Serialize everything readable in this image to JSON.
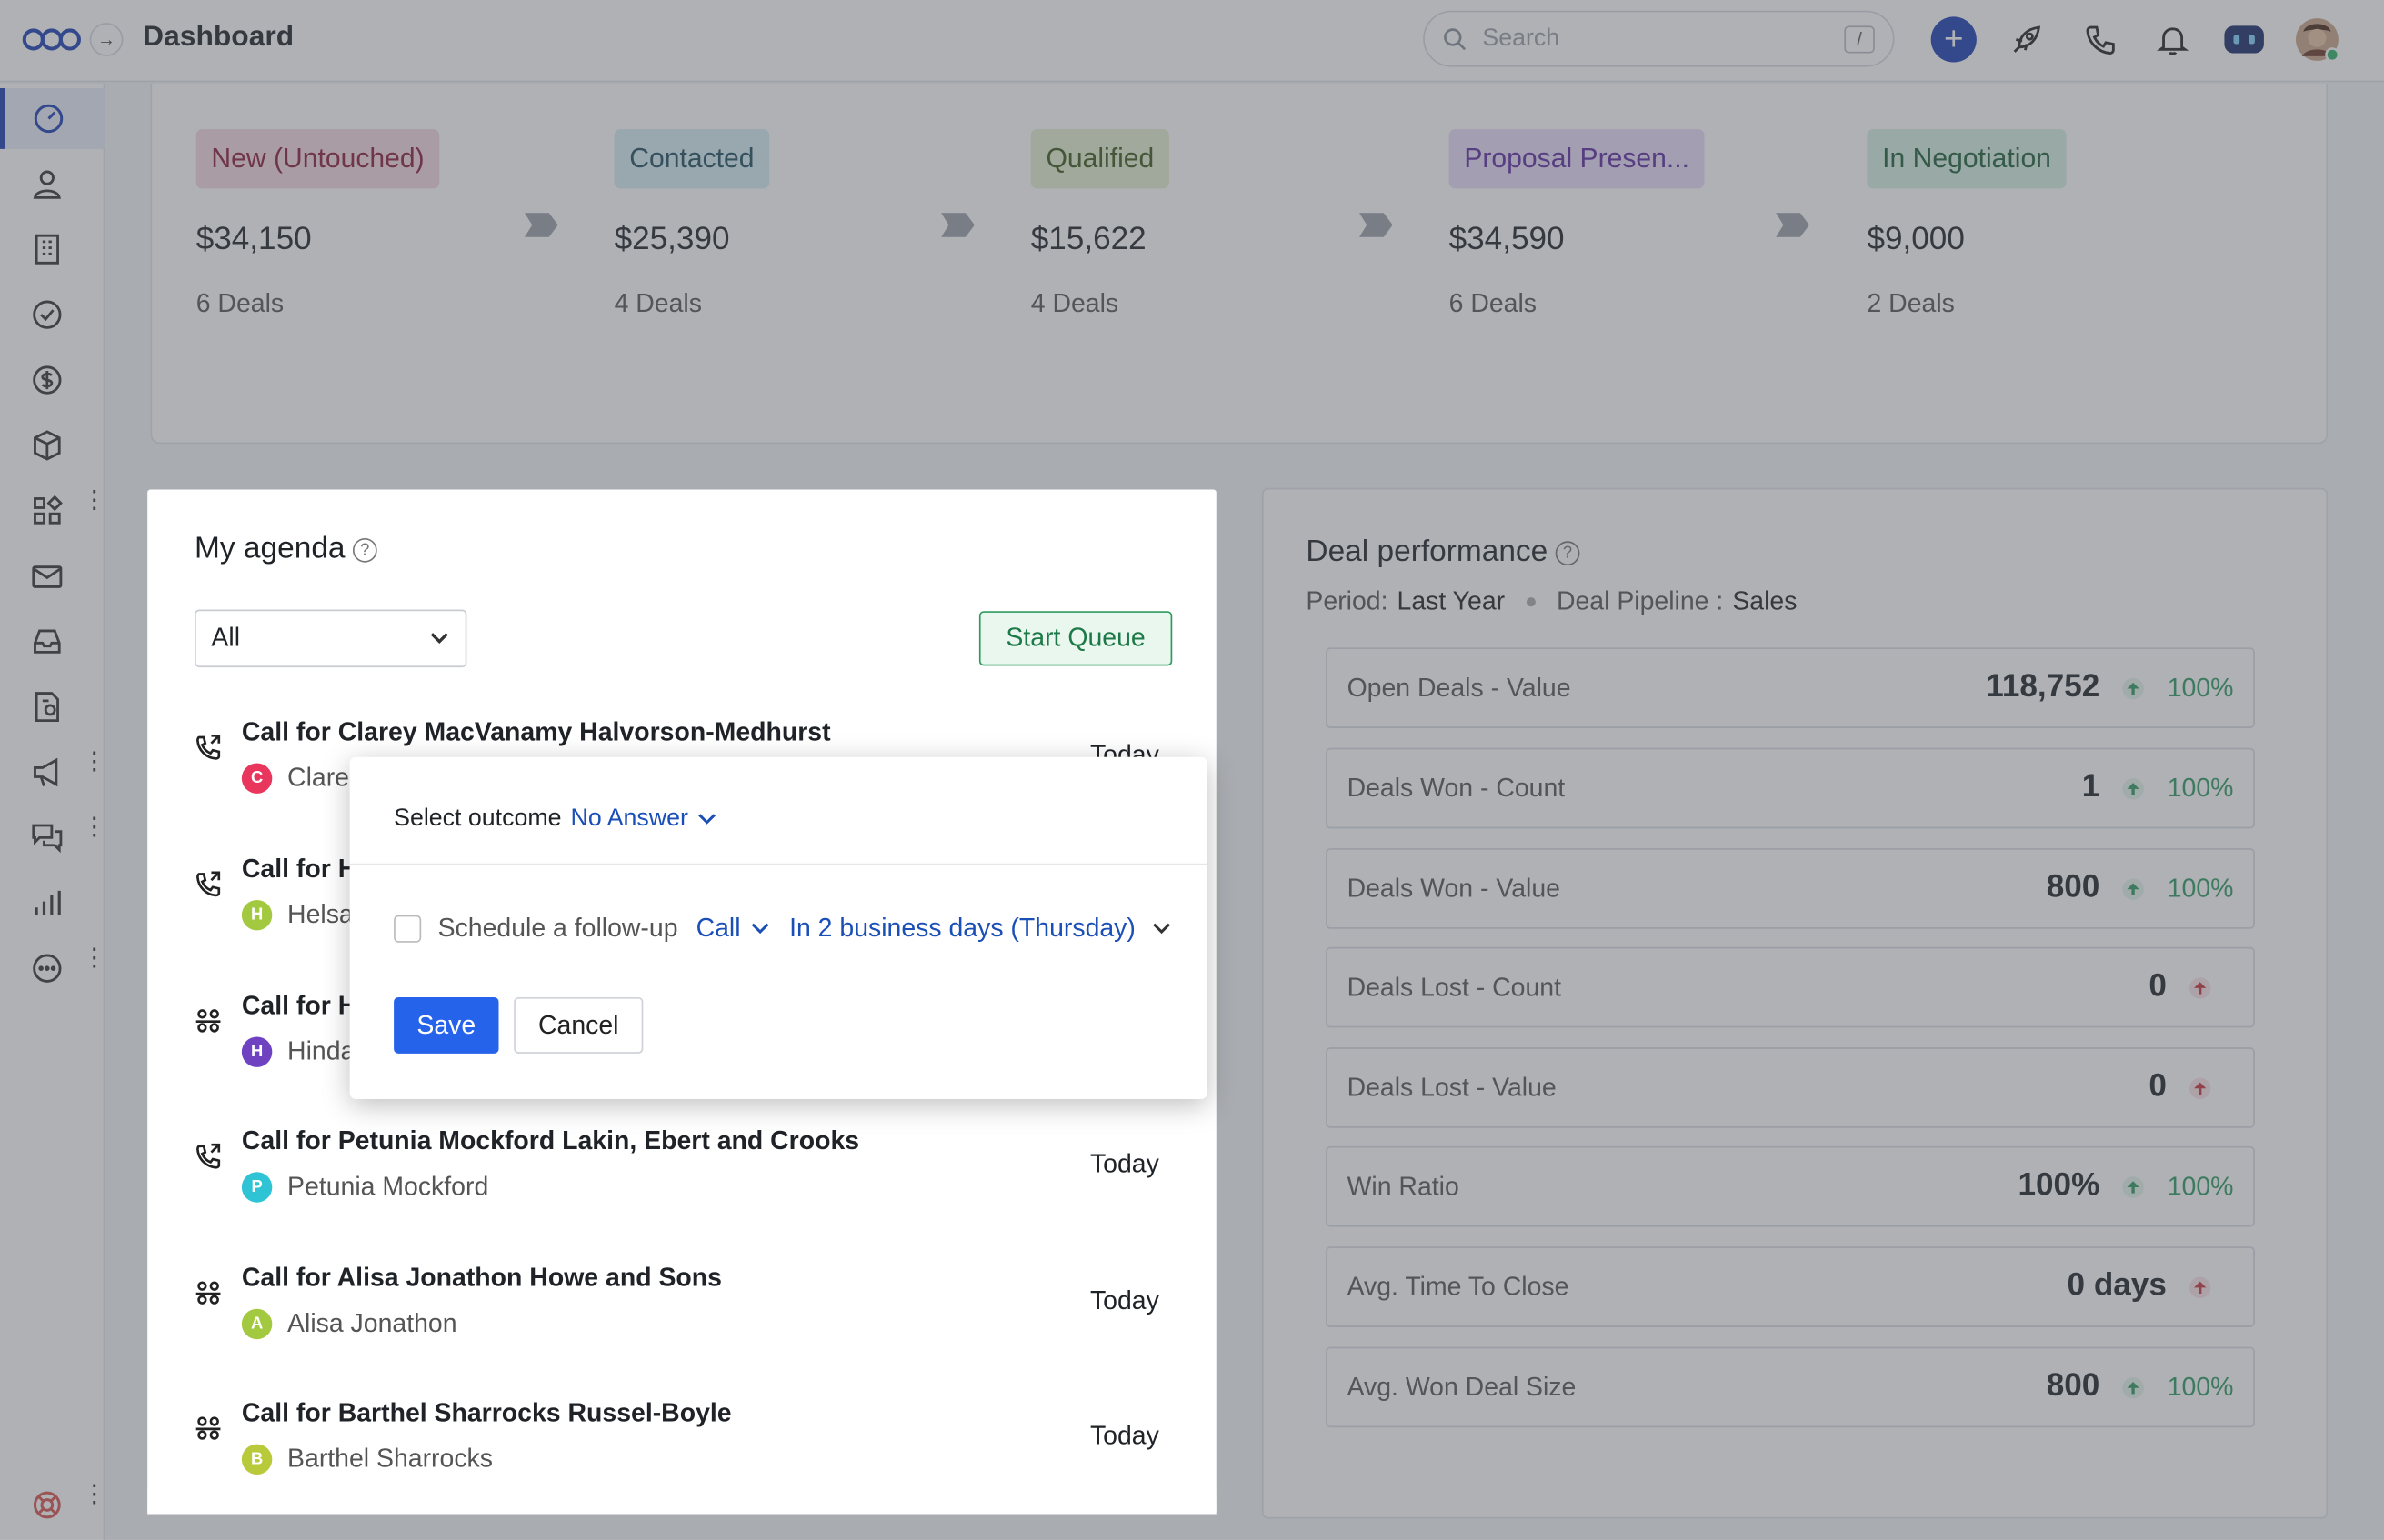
{
  "header": {
    "title": "Dashboard",
    "search_placeholder": "Search",
    "search_shortcut": "/"
  },
  "pipeline": {
    "stages": [
      {
        "name": "New (Untouched)",
        "amount": "$34,150",
        "deals": "6 Deals",
        "bg": "#f6d9df",
        "fg": "#8a1d3a"
      },
      {
        "name": "Contacted",
        "amount": "$25,390",
        "deals": "4 Deals",
        "bg": "#d6ecf3",
        "fg": "#1f4e5f"
      },
      {
        "name": "Qualified",
        "amount": "$15,622",
        "deals": "4 Deals",
        "bg": "#e4f1cf",
        "fg": "#3d5718"
      },
      {
        "name": "Proposal Presen...",
        "amount": "$34,590",
        "deals": "6 Deals",
        "bg": "#e9ddf9",
        "fg": "#5b2c9f"
      },
      {
        "name": "In Negotiation",
        "amount": "$9,000",
        "deals": "2 Deals",
        "bg": "#d7f1e1",
        "fg": "#1e5f3a"
      }
    ]
  },
  "agenda": {
    "title": "My agenda",
    "filter_value": "All",
    "start_queue_label": "Start Queue",
    "items": [
      {
        "title": "Call for Clarey MacVanamy Halvorson-Medhurst",
        "contact": "Clare",
        "initial": "C",
        "badge_color": "#e8365d",
        "when": "Today"
      },
      {
        "title": "Call for H",
        "contact": "Helsa",
        "initial": "H",
        "badge_color": "#a3c940",
        "when": ""
      },
      {
        "title": "Call for H",
        "contact": "Hinda",
        "initial": "H",
        "badge_color": "#6f42c1",
        "when": ""
      },
      {
        "title": "Call for Petunia Mockford Lakin, Ebert and Crooks",
        "contact": "Petunia Mockford",
        "initial": "P",
        "badge_color": "#2ec4d6",
        "when": "Today"
      },
      {
        "title": "Call for Alisa Jonathon Howe and Sons",
        "contact": "Alisa Jonathon",
        "initial": "A",
        "badge_color": "#a3c940",
        "when": "Today"
      },
      {
        "title": "Call for Barthel Sharrocks Russel-Boyle",
        "contact": "Barthel Sharrocks",
        "initial": "B",
        "badge_color": "#b8c93a",
        "when": "Today"
      }
    ]
  },
  "popover": {
    "outcome_label": "Select outcome",
    "outcome_value": "No Answer",
    "followup_label": "Schedule a follow-up",
    "followup_type": "Call",
    "followup_when": "In 2 business days (Thursday)",
    "save_label": "Save",
    "cancel_label": "Cancel"
  },
  "performance": {
    "title": "Deal performance",
    "period_label": "Period:",
    "period_value": "Last Year",
    "pipeline_label": "Deal Pipeline :",
    "pipeline_value": "Sales",
    "metrics": [
      {
        "label": "Open Deals - Value",
        "value": "118,752",
        "pct": "100%",
        "trend": "up-green"
      },
      {
        "label": "Deals Won - Count",
        "value": "1",
        "pct": "100%",
        "trend": "up-green"
      },
      {
        "label": "Deals Won - Value",
        "value": "800",
        "pct": "100%",
        "trend": "up-green"
      },
      {
        "label": "Deals Lost - Count",
        "value": "0",
        "pct": "",
        "trend": "up-red"
      },
      {
        "label": "Deals Lost - Value",
        "value": "0",
        "pct": "",
        "trend": "up-red"
      },
      {
        "label": "Win Ratio",
        "value": "100%",
        "pct": "100%",
        "trend": "up-green"
      },
      {
        "label": "Avg. Time To Close",
        "value": "0 days",
        "pct": "",
        "trend": "up-red"
      },
      {
        "label": "Avg. Won Deal Size",
        "value": "800",
        "pct": "100%",
        "trend": "up-green"
      }
    ]
  },
  "colors": {
    "accent": "#1b3fb4",
    "primary_button": "#2563eb",
    "positive": "#2f9a60",
    "negative": "#c8323c"
  },
  "icons": {
    "sidebar": [
      "dashboard-gauge-icon",
      "contacts-person-icon",
      "companies-building-icon",
      "tasks-check-icon",
      "deals-dollar-icon",
      "products-box-icon",
      "apps-grid-icon",
      "mail-icon",
      "inbox-tray-icon",
      "documents-icon",
      "campaigns-megaphone-icon",
      "chat-bubbles-icon",
      "reports-bars-icon",
      "more-circle-icon",
      "help-lifebuoy-icon"
    ],
    "header": [
      "logo-icon",
      "expand-arrow-icon",
      "search-icon",
      "plus-icon",
      "rocket-icon",
      "phone-icon",
      "bell-icon",
      "assistant-bot-icon",
      "user-avatar"
    ]
  }
}
